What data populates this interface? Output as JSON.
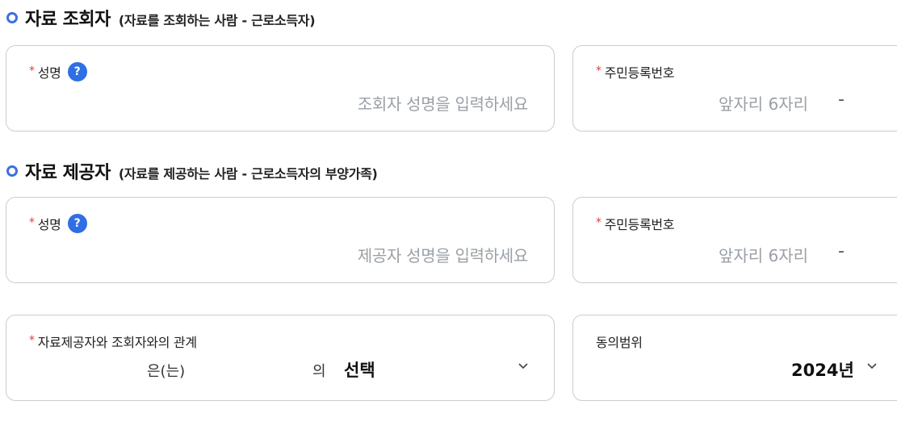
{
  "viewer_section": {
    "title": "자료 조회자",
    "subtitle": "(자료를 조회하는 사람 - 근로소득자)",
    "name_label": "성명",
    "name_placeholder": "조회자 성명을 입력하세요",
    "rrn_label": "주민등록번호",
    "rrn_front_placeholder": "앞자리 6자리",
    "rrn_separator": "-"
  },
  "provider_section": {
    "title": "자료 제공자",
    "subtitle": "(자료를 제공하는 사람 - 근로소득자의 부양가족)",
    "name_label": "성명",
    "name_placeholder": "제공자 성명을 입력하세요",
    "rrn_label": "주민등록번호",
    "rrn_front_placeholder": "앞자리 6자리",
    "rrn_separator": "-"
  },
  "relationship": {
    "label": "자료제공자와 조회자와의 관계",
    "subject_text": "은(는)",
    "of_text": "의",
    "selected": "선택"
  },
  "consent_scope": {
    "label": "동의범위",
    "selected_year": "2024년"
  },
  "common": {
    "required_mark": "*",
    "help_glyph": "?",
    "chevron_glyph": "⌄"
  },
  "icons": {
    "section_bullet": "circle-bullet-icon",
    "help": "question-circle-icon",
    "dropdown": "chevron-down-icon"
  },
  "colors": {
    "accent": "#2f6fe4",
    "required": "#e03b3b",
    "border": "#c9cdd2",
    "placeholder": "#9aa0a6"
  }
}
